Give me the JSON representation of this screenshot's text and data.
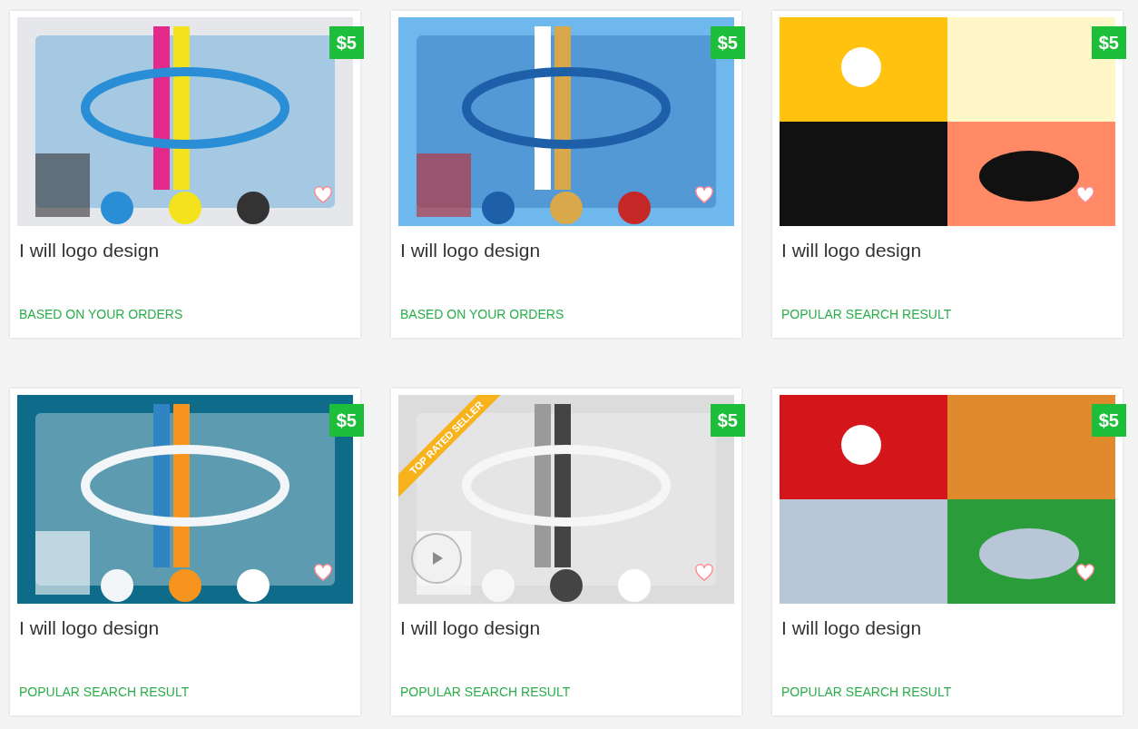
{
  "cards": [
    {
      "title": "I will logo design",
      "tag": "BASED ON YOUR ORDERS",
      "price": "$5",
      "favorited": false,
      "video": false
    },
    {
      "title": "I will logo design",
      "tag": "BASED ON YOUR ORDERS",
      "price": "$5",
      "favorited": false,
      "video": false
    },
    {
      "title": "I will logo design",
      "tag": "POPULAR SEARCH RESULT",
      "price": "$5",
      "favorited": false,
      "video": false
    },
    {
      "title": "I will logo design",
      "tag": "POPULAR SEARCH RESULT",
      "price": "$5",
      "favorited": false,
      "video": false
    },
    {
      "title": "I will logo design",
      "tag": "POPULAR SEARCH RESULT",
      "price": "$5",
      "favorited": false,
      "video": true,
      "ribbon": "TOP RATED SELLER"
    },
    {
      "title": "I will logo design",
      "tag": "POPULAR SEARCH RESULT",
      "price": "$5",
      "favorited": false,
      "video": false
    }
  ]
}
